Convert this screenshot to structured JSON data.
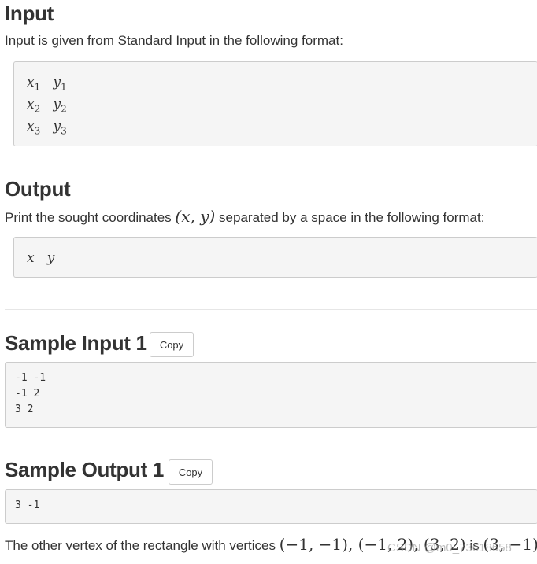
{
  "input": {
    "title": "Input",
    "desc": "Input is given from Standard Input in the following format:",
    "format": [
      [
        "x",
        "1",
        "y",
        "1"
      ],
      [
        "x",
        "2",
        "y",
        "2"
      ],
      [
        "x",
        "3",
        "y",
        "3"
      ]
    ]
  },
  "output": {
    "title": "Output",
    "desc_before": "Print the sought coordinates ",
    "desc_math": "(x, y)",
    "desc_after": " separated by a space in the following format:",
    "format": "x   y"
  },
  "sample_input": {
    "title": "Sample Input 1",
    "copy": "Copy",
    "content": "-1 -1\n-1 2\n3 2"
  },
  "sample_output": {
    "title": "Sample Output 1",
    "copy": "Copy",
    "content": "3 -1"
  },
  "explanation": {
    "text": "The other vertex of the rectangle with vertices ",
    "math": "(−1, −1), (−1, 2), (3, 2)",
    "is": " is ",
    "answer": "(3, −1)",
    "end": "."
  },
  "watermark": "CSDN @m0_73618658"
}
